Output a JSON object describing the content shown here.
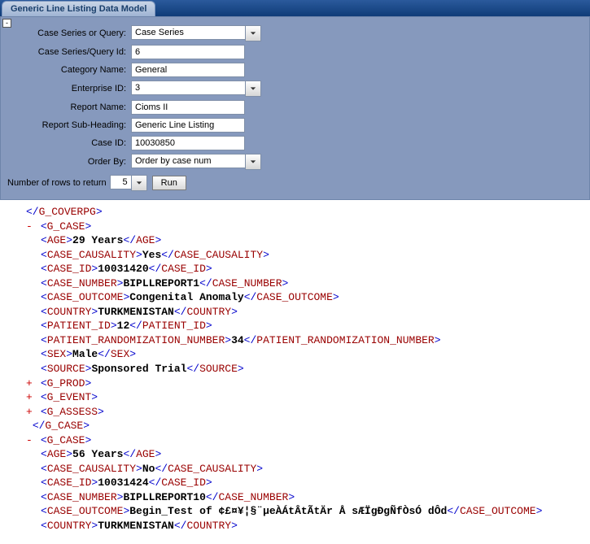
{
  "tab_title": "Generic Line Listing Data Model",
  "collapse_glyph": "-",
  "form": {
    "case_series_query": {
      "label": "Case Series or Query:",
      "value": "Case Series"
    },
    "case_series_id": {
      "label": "Case Series/Query Id:",
      "value": "6"
    },
    "category_name": {
      "label": "Category Name:",
      "value": "General"
    },
    "enterprise_id": {
      "label": "Enterprise ID:",
      "value": "3"
    },
    "report_name": {
      "label": "Report Name:",
      "value": "Cioms II"
    },
    "sub_heading": {
      "label": "Report Sub-Heading:",
      "value": "Generic Line Listing"
    },
    "case_id": {
      "label": "Case ID:",
      "value": "10030850"
    },
    "order_by": {
      "label": "Order By:",
      "value": "Order by case num"
    }
  },
  "rows_label": "Number of rows to return",
  "rows_value": "5",
  "run_label": "Run",
  "xml": {
    "close_coverpg": "G_COVERPG",
    "g_case": "G_CASE",
    "g_prod": "G_PROD",
    "g_event": "G_EVENT",
    "g_assess": "G_ASSESS",
    "case1": {
      "AGE": "29 Years",
      "CASE_CAUSALITY": "Yes",
      "CASE_ID": "10031420",
      "CASE_NUMBER": "BIPLLREPORT1",
      "CASE_OUTCOME": "Congenital Anomaly",
      "COUNTRY": "TURKMENISTAN",
      "PATIENT_ID": "12",
      "PATIENT_RANDOMIZATION_NUMBER": "34",
      "SEX": "Male",
      "SOURCE": "Sponsored Trial"
    },
    "case2": {
      "AGE": "56 Years",
      "CASE_CAUSALITY": "No",
      "CASE_ID": "10031424",
      "CASE_NUMBER": "BIPLLREPORT10",
      "CASE_OUTCOME": "Begin_Test of ¢£¤¥¦§¨µeÀÁtÂtÃtÄr Å sÆÏgÐgÑfÒsÓ dÔd",
      "COUNTRY": "TURKMENISTAN"
    }
  }
}
